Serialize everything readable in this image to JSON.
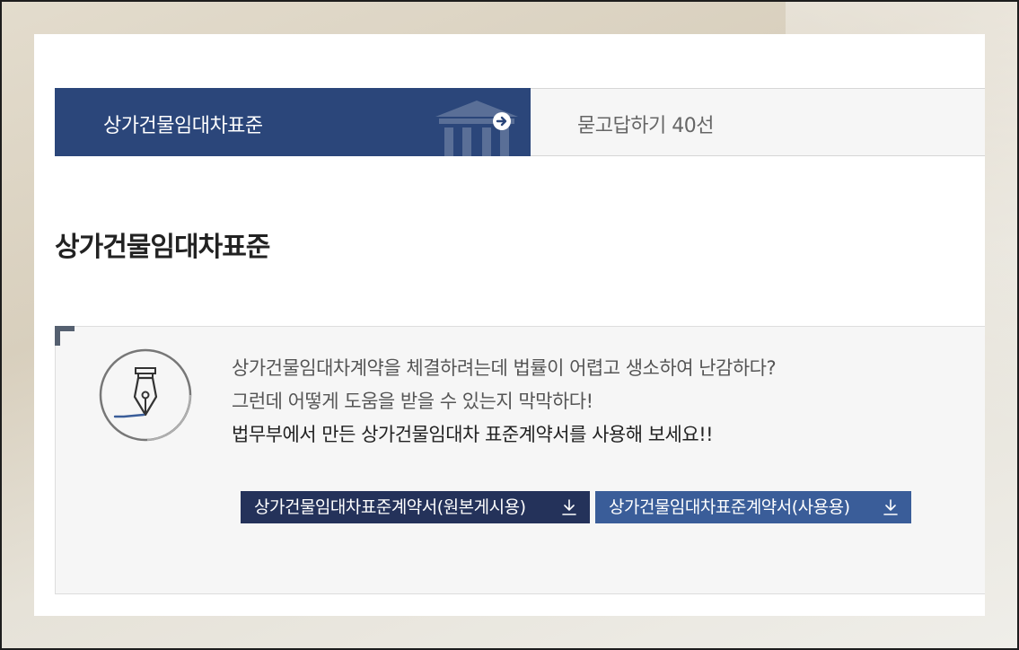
{
  "tabs": [
    {
      "label": "상가건물임대차표준",
      "active": true
    },
    {
      "label": "묻고답하기 40선",
      "active": false
    }
  ],
  "page": {
    "title": "상가건물임대차표준"
  },
  "intro": {
    "lines": [
      "상가건물임대차계약을 체결하려는데 법률이 어렵고 생소하여 난감하다?",
      "그런데 어떻게 도움을 받을 수 있는지 막막하다!",
      "법무부에서 만든 상가건물임대차 표준계약서를 사용해 보세요!!"
    ]
  },
  "downloads": {
    "original_label": "상가건물임대차표준계약서(원본게시용)",
    "use_label": "상가건물임대차표준계약서(사용용)"
  },
  "icons": {
    "tab_arrow": "arrow-right-circle-icon",
    "tab_bg": "building-icon",
    "feature": "fountain-pen-icon",
    "download": "download-icon"
  },
  "colors": {
    "active_tab": "#2b467a",
    "btn_original": "#24325a",
    "btn_use": "#3a5d99"
  }
}
